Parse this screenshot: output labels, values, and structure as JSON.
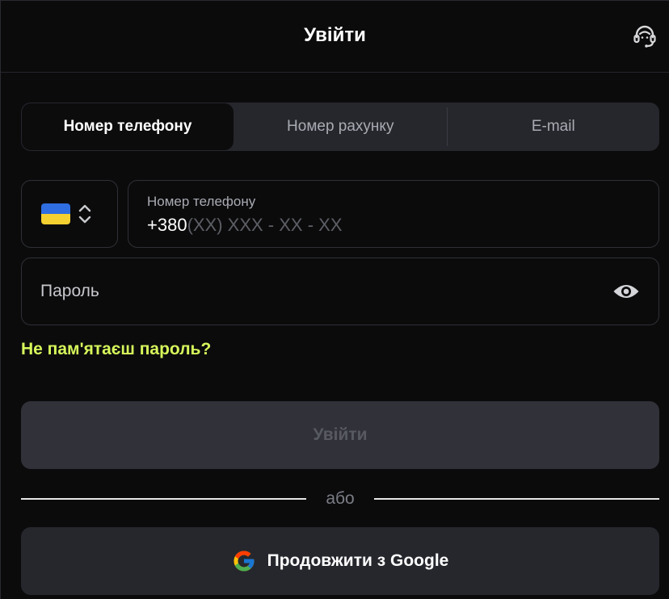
{
  "header": {
    "title": "Увійти",
    "support_icon": "headset-icon"
  },
  "tabs": [
    {
      "label": "Номер телефону",
      "active": true
    },
    {
      "label": "Номер рахунку",
      "active": false
    },
    {
      "label": "E-mail",
      "active": false
    }
  ],
  "phone": {
    "country_flag": "ukraine-flag-icon",
    "label": "Номер телефону",
    "prefix": "+380",
    "mask": "(XX) XXX - XX - XX"
  },
  "password": {
    "placeholder": "Пароль",
    "toggle_icon": "eye-icon"
  },
  "forgot_password": "Не пам'ятаєш пароль?",
  "login_button": "Увійти",
  "divider_text": "або",
  "google_button": "Продовжити з Google",
  "colors": {
    "accent": "#d6f75a",
    "background": "#0b0b0c",
    "tab_bg": "#26272d",
    "disabled_button": "#303139"
  }
}
